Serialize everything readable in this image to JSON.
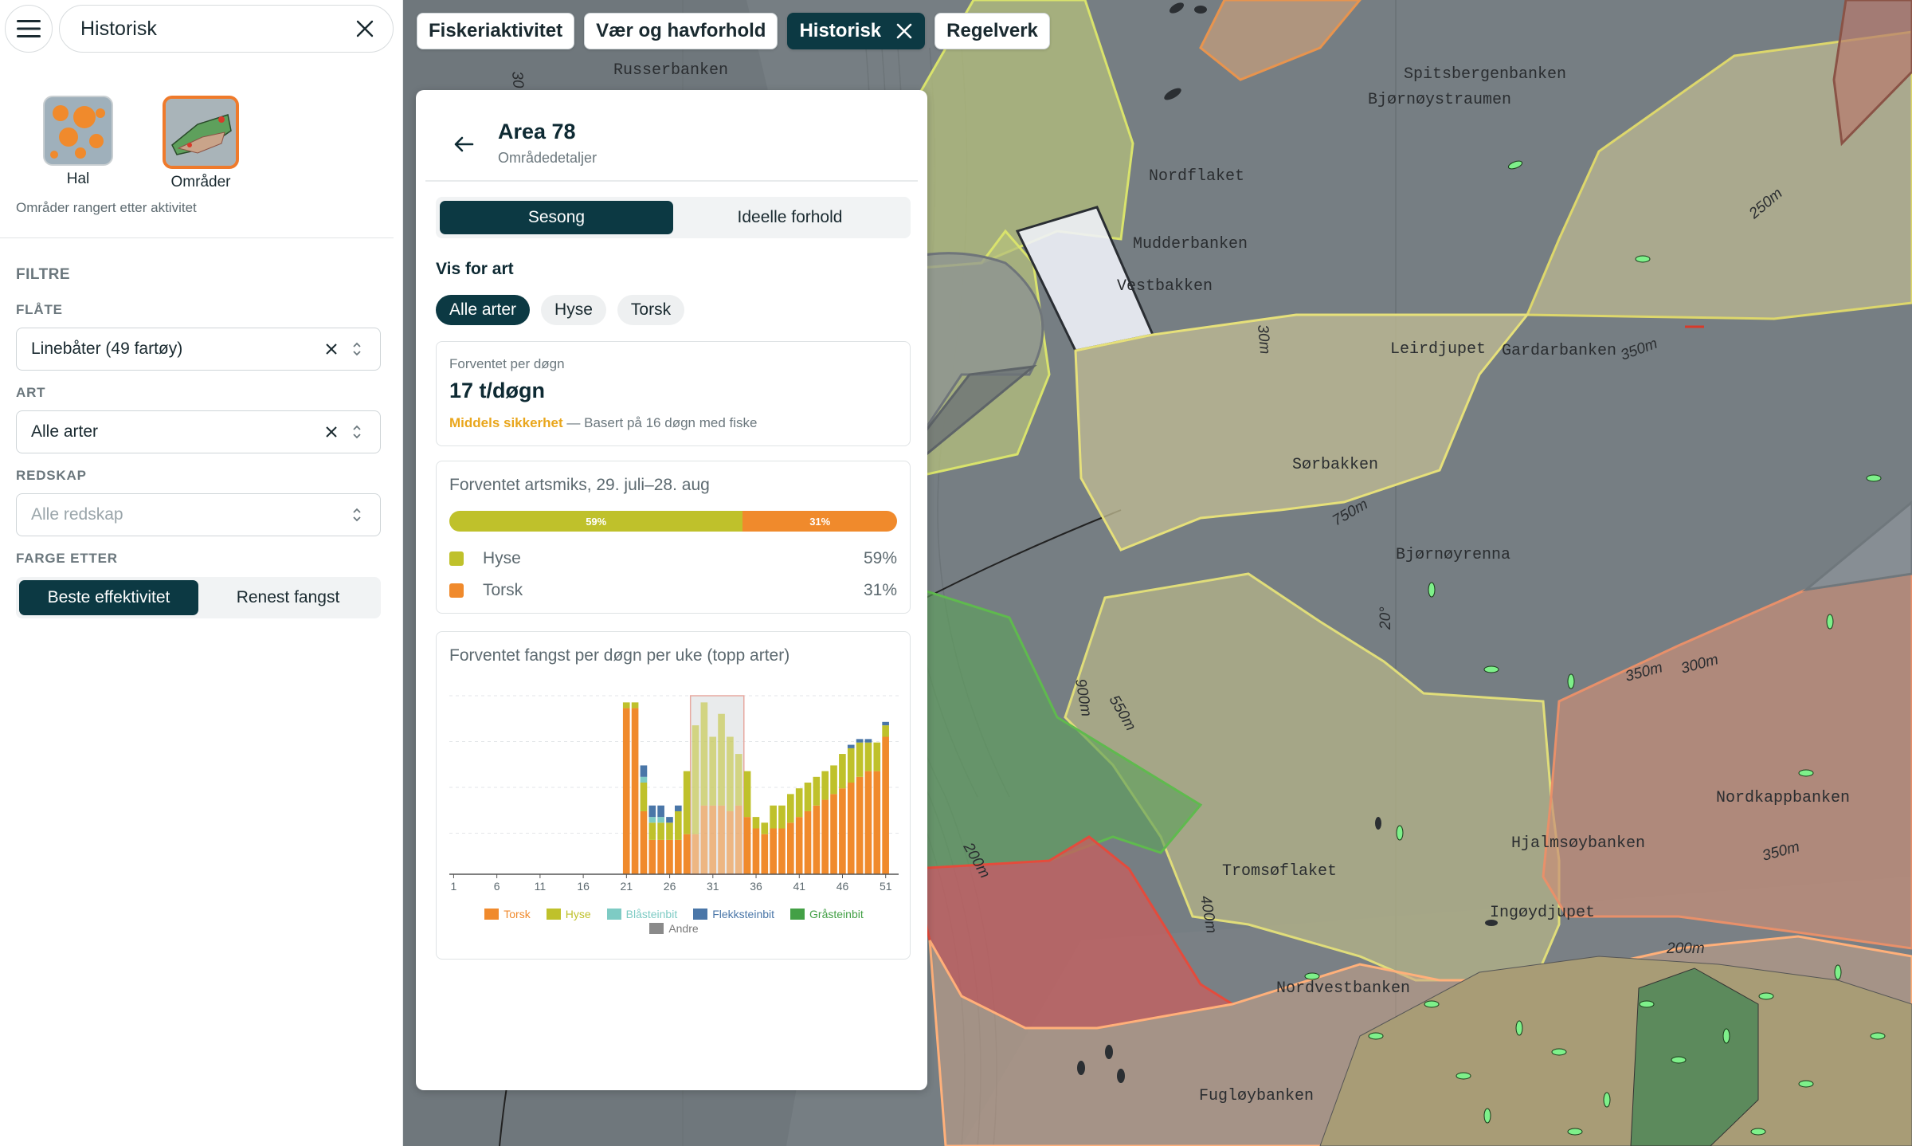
{
  "search": {
    "value": "Historisk"
  },
  "layers": [
    {
      "label": "Hal",
      "active": false
    },
    {
      "label": "Områder",
      "active": true
    }
  ],
  "layer_caption": "Områder rangert etter aktivitet",
  "filters": {
    "title": "FILTRE",
    "fleet": {
      "label": "FLÅTE",
      "value": "Linebåter (49 fartøy)"
    },
    "species": {
      "label": "ART",
      "value": "Alle arter"
    },
    "gear": {
      "label": "REDSKAP",
      "placeholder": "Alle redskap"
    },
    "color_by": {
      "label": "FARGE ETTER",
      "options": [
        "Beste effektivitet",
        "Renest fangst"
      ],
      "selected": "Beste effektivitet"
    }
  },
  "chips": [
    {
      "label": "Fiskeriaktivitet",
      "active": false
    },
    {
      "label": "Vær og havforhold",
      "active": false
    },
    {
      "label": "Historisk",
      "active": true
    },
    {
      "label": "Regelverk",
      "active": false
    }
  ],
  "panel": {
    "title": "Area 78",
    "subtitle": "Områdedetaljer",
    "tabs": [
      "Sesong",
      "Ideelle forhold"
    ],
    "active_tab": "Sesong",
    "species_label": "Vis for art",
    "species_options": [
      "Alle arter",
      "Hyse",
      "Torsk"
    ],
    "species_selected": "Alle arter",
    "expected": {
      "label": "Forventet per døgn",
      "value": "17 t/døgn",
      "confidence": "Middels sikkerhet",
      "basis": " — Basert på 16 døgn med fiske"
    },
    "mix": {
      "title": "Forventet artsmiks, 29. juli–28. aug",
      "items": [
        {
          "name": "Hyse",
          "pct": "59%",
          "fraction": 0.59,
          "color": "#bfc12b"
        },
        {
          "name": "Torsk",
          "pct": "31%",
          "fraction": 0.31,
          "color": "#f08a2c"
        }
      ]
    },
    "weekly_title": "Forventet fangst per døgn per uke (topp arter)"
  },
  "map_labels": [
    "Russerbanken",
    "Spitsbergenbanken",
    "Bjørnøystraumen",
    "Nordflaket",
    "Mudderbanken",
    "Vestbakken",
    "Leirdjupet",
    "Gardarbanken",
    "Sørbakken",
    "Bjørnøyrenna",
    "Tromsøflaket",
    "Hjalmsøybanken",
    "Ingøydjupet",
    "Nordkappbanken",
    "Nordvestbanken",
    "Fugløybanken",
    "250m",
    "350m",
    "750m",
    "300m",
    "900m",
    "550m",
    "200m",
    "400m",
    "30m",
    "20°",
    "30"
  ],
  "chart_data": {
    "type": "bar",
    "stacked": true,
    "title": "Forventet fangst per døgn per uke (topp arter)",
    "xlabel": "",
    "ylabel": "",
    "x_ticks": [
      "1",
      "6",
      "11",
      "16",
      "21",
      "26",
      "31",
      "36",
      "41",
      "46",
      "51"
    ],
    "x": [
      21,
      22,
      23,
      24,
      25,
      26,
      27,
      28,
      29,
      30,
      31,
      32,
      33,
      34,
      35,
      36,
      37,
      38,
      39,
      40,
      41,
      42,
      43,
      44,
      45,
      46,
      47,
      48,
      49,
      50,
      51
    ],
    "ylim": [
      0,
      16
    ],
    "highlight_weeks": [
      29,
      34
    ],
    "grid": true,
    "legend_position": "bottom",
    "series": [
      {
        "name": "Torsk",
        "color": "#f08a2c",
        "values": [
          14.5,
          14.5,
          5.5,
          3,
          3,
          3,
          3,
          3.5,
          3.5,
          6,
          6,
          6,
          5.5,
          6,
          5,
          4,
          3.5,
          4,
          4,
          4.5,
          5,
          5.5,
          6,
          6.5,
          7,
          7.5,
          8,
          8.5,
          9,
          9,
          12
        ]
      },
      {
        "name": "Hyse",
        "color": "#bfc12b",
        "values": [
          0.5,
          0.5,
          2.5,
          1.5,
          1.5,
          1.5,
          2.5,
          5.5,
          9.5,
          9,
          6,
          8,
          6.5,
          4.5,
          4,
          1,
          1,
          2,
          2,
          2.5,
          2.5,
          2.5,
          2.5,
          2.5,
          2.5,
          3,
          3,
          3,
          2.5,
          2.5,
          1
        ]
      },
      {
        "name": "Blåsteinbit",
        "color": "#7ecbc4",
        "values": [
          0,
          0,
          0.5,
          0.5,
          0.5,
          0,
          0,
          0,
          0,
          0,
          0,
          0,
          0,
          0,
          0,
          0,
          0,
          0,
          0,
          0,
          0,
          0,
          0,
          0,
          0,
          0,
          0,
          0,
          0,
          0,
          0
        ]
      },
      {
        "name": "Flekksteinbit",
        "color": "#4a76a8",
        "values": [
          0,
          0,
          1,
          1,
          1,
          0.5,
          0.5,
          0,
          0,
          0,
          0,
          0,
          0,
          0,
          0,
          0,
          0,
          0,
          0,
          0,
          0,
          0,
          0,
          0,
          0,
          0,
          0.3,
          0.3,
          0.3,
          0,
          0.3
        ]
      },
      {
        "name": "Gråsteinbit",
        "color": "#43a046",
        "values": [
          0,
          0,
          0,
          0,
          0,
          0,
          0,
          0,
          0,
          0,
          0,
          0,
          0,
          0,
          0,
          0,
          0,
          0,
          0,
          0,
          0,
          0,
          0,
          0,
          0,
          0,
          0,
          0,
          0,
          0,
          0
        ]
      },
      {
        "name": "Andre",
        "color": "#8a8a8a",
        "values": [
          0,
          0,
          0,
          0,
          0,
          0,
          0,
          0,
          0,
          0,
          0,
          0,
          0,
          0,
          0,
          0,
          0,
          0,
          0,
          0,
          0,
          0,
          0,
          0,
          0,
          0,
          0,
          0,
          0,
          0,
          0
        ]
      }
    ]
  }
}
